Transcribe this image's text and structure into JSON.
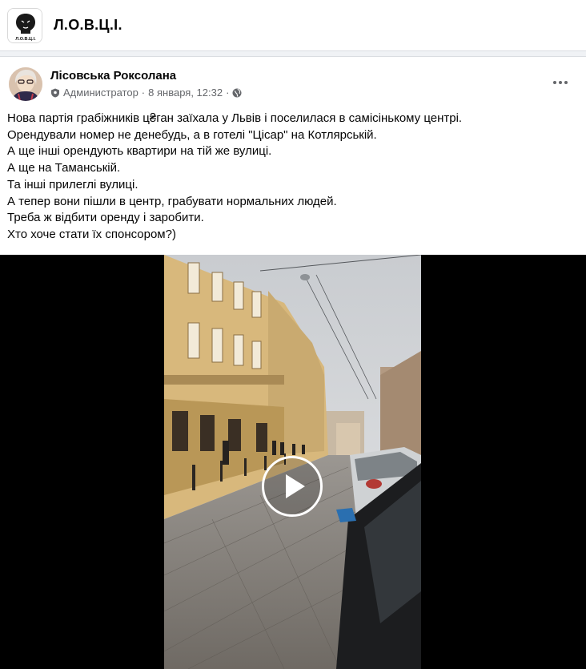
{
  "group": {
    "name": "Л.О.В.Ц.І.",
    "logo_text": "Л.О.В.Ц.І."
  },
  "post": {
    "author": "Лісовська Роксолана",
    "role": "Администратор",
    "separator": "·",
    "date": "8 января, 12:32",
    "lines": [
      "Нова партія грабіжників ц₴ган заїхала у Львів і поселилася в самісінькому центрі.",
      "Орендували номер не денебудь, а в готелі \"Цісар\" на Котлярській.",
      "А ще інші орендують квартири на тій же вулиці.",
      "А ще на Таманській.",
      "Та інші прилеглі вулиці.",
      "А тепер вони пішли в центр, грабувати нормальних людей.",
      "Треба ж відбити оренду і заробити.",
      "Хто хоче стати їх спонсором?)"
    ]
  },
  "video": {
    "play_icon": "play-icon"
  },
  "colors": {
    "text": "#050505",
    "secondary": "#65676b",
    "page_bg": "#f0f2f5"
  }
}
